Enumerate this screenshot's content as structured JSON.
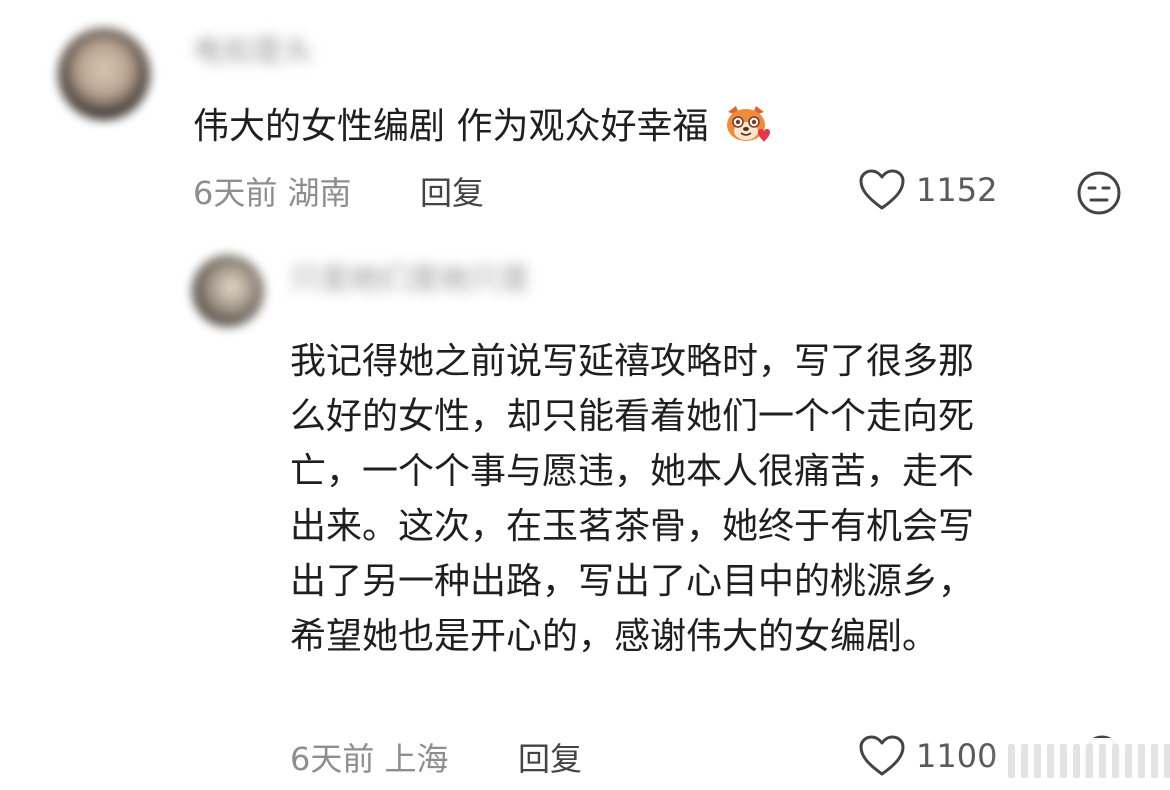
{
  "comment": {
    "username": "电如是头",
    "text": "伟大的女性编剧 作为观众好幸福",
    "emoji_icon": "fox-heart-emoji-icon",
    "time": "6天前",
    "location": "湖南",
    "reply_label": "回复",
    "like_count": "1152"
  },
  "reply": {
    "username": "只是她们是她只是",
    "lines": [
      "我记得她之前说写延禧攻略时，写了很多那",
      "么好的女性，却只能看着她们一个个走向死",
      "亡，一个个事与愿违，她本人很痛苦，走不",
      "出来。这次，在玉茗茶骨，她终于有机会写",
      "出了另一种出路，写出了心目中的桃源乡，",
      "希望她也是开心的，感谢伟大的女编剧。"
    ],
    "time": "6天前",
    "location": "上海",
    "reply_label": "回复",
    "like_count": "1100"
  },
  "colors": {
    "text": "#1f1f1f",
    "meta": "#8e8e8e",
    "icon": "#444444"
  }
}
